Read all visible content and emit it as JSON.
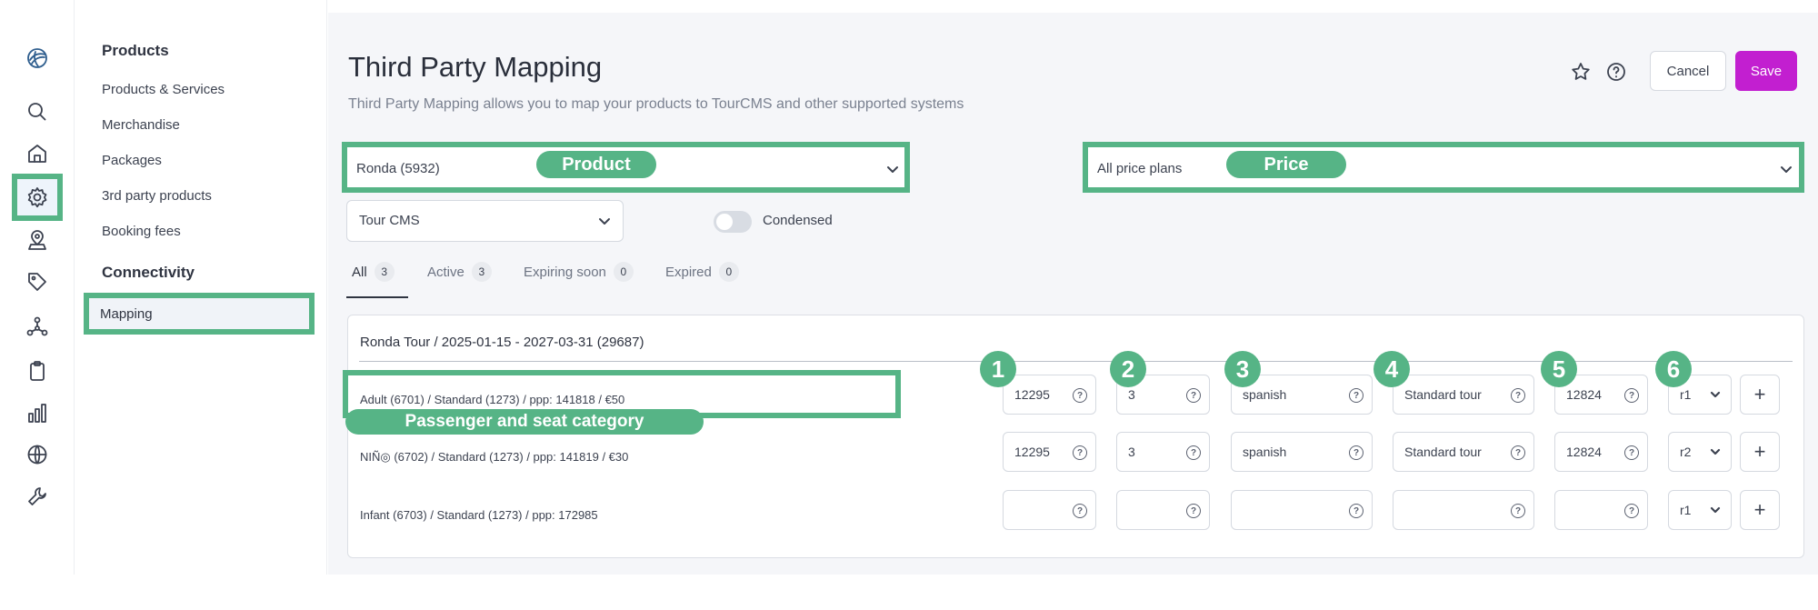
{
  "rail": {
    "icons": [
      "logo-icon",
      "search-icon",
      "home-icon",
      "gear-icon",
      "user-pin-icon",
      "tag-icon",
      "network-icon",
      "clipboard-icon",
      "bar-chart-icon",
      "globe-icon",
      "wrench-icon"
    ],
    "highlight_color": "#56b486"
  },
  "subnav": {
    "products_heading": "Products",
    "items": [
      "Products & Services",
      "Merchandise",
      "Packages",
      "3rd party products",
      "Booking fees"
    ],
    "connectivity_heading": "Connectivity",
    "mapping_label": "Mapping"
  },
  "header": {
    "title": "Third Party Mapping",
    "subtitle": "Third Party Mapping allows you to map your products to TourCMS and other supported systems",
    "cancel_label": "Cancel",
    "save_label": "Save",
    "save_color": "#c21fd0"
  },
  "filters": {
    "product_value": "Ronda (5932)",
    "product_annotation": "Product",
    "price_value": "All price plans",
    "price_annotation": "Price",
    "system_value": "Tour CMS",
    "condensed_label": "Condensed",
    "condensed_on": false
  },
  "tabs": [
    {
      "label": "All",
      "count": "3",
      "active": true
    },
    {
      "label": "Active",
      "count": "3",
      "active": false
    },
    {
      "label": "Expiring soon",
      "count": "0",
      "active": false
    },
    {
      "label": "Expired",
      "count": "0",
      "active": false
    }
  ],
  "card": {
    "title": "Ronda Tour / 2025-01-15 - 2027-03-31 (29687)",
    "passenger_annotation": "Passenger and seat category",
    "column_badges": [
      "1",
      "2",
      "3",
      "4",
      "5",
      "6"
    ],
    "help_glyph": "?",
    "add_glyph": "+",
    "rows": [
      {
        "label": "Adult (6701) / Standard (1273) / ppp: 141818 / €50",
        "f1": "12295",
        "f2": "3",
        "f3": "spanish",
        "f4": "Standard tour",
        "f5": "12824",
        "f6": "r1"
      },
      {
        "label": "NIÑ◎ (6702) / Standard (1273) / ppp: 141819 / €30",
        "f1": "12295",
        "f2": "3",
        "f3": "spanish",
        "f4": "Standard tour",
        "f5": "12824",
        "f6": "r2"
      },
      {
        "label": "Infant (6703) / Standard (1273) / ppp: 172985",
        "f1": "",
        "f2": "",
        "f3": "",
        "f4": "",
        "f5": "",
        "f6": "r1"
      }
    ]
  }
}
